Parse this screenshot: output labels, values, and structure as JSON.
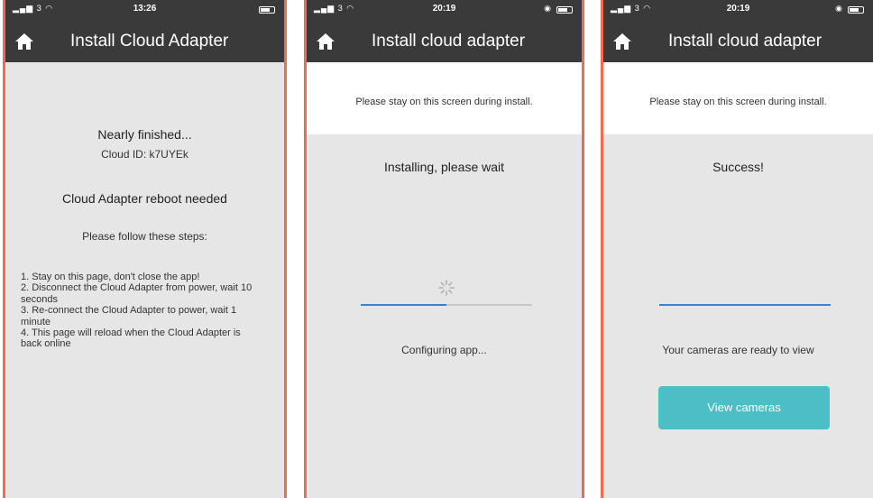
{
  "screens": [
    {
      "status": {
        "signal": "3",
        "time": "13:26"
      },
      "nav": {
        "title": "Install Cloud Adapter"
      },
      "body": {
        "heading": "Nearly finished...",
        "cloud_id": "Cloud ID: k7UYEk",
        "subheading": "Cloud Adapter reboot needed",
        "instruction": "Please follow these steps:",
        "steps": [
          "1. Stay on this page, don't close the app!",
          "2. Disconnect the Cloud Adapter from power, wait 10 seconds",
          "3. Re-connect the Cloud Adapter to power, wait 1 minute",
          "4. This page will reload when the Cloud Adapter is back online"
        ]
      }
    },
    {
      "status": {
        "signal": "3",
        "time": "20:19"
      },
      "nav": {
        "title": "Install cloud adapter"
      },
      "notice": "Please stay on this screen during install.",
      "body": {
        "heading": "Installing, please wait",
        "progress": 0.5,
        "progress_color": "#3d7fd0",
        "status_text": "Configuring app..."
      }
    },
    {
      "status": {
        "signal": "3",
        "time": "20:19"
      },
      "nav": {
        "title": "Install cloud adapter"
      },
      "notice": "Please stay on this screen during install.",
      "body": {
        "heading": "Success!",
        "progress": 1.0,
        "progress_color": "#3d7fd0",
        "ready_text": "Your cameras are ready to view",
        "button_label": "View cameras",
        "button_color": "#4ebec6"
      }
    }
  ],
  "colors": {
    "header": "#3a3a3a",
    "border": "#f26b4e",
    "background": "#e6e6e6"
  }
}
